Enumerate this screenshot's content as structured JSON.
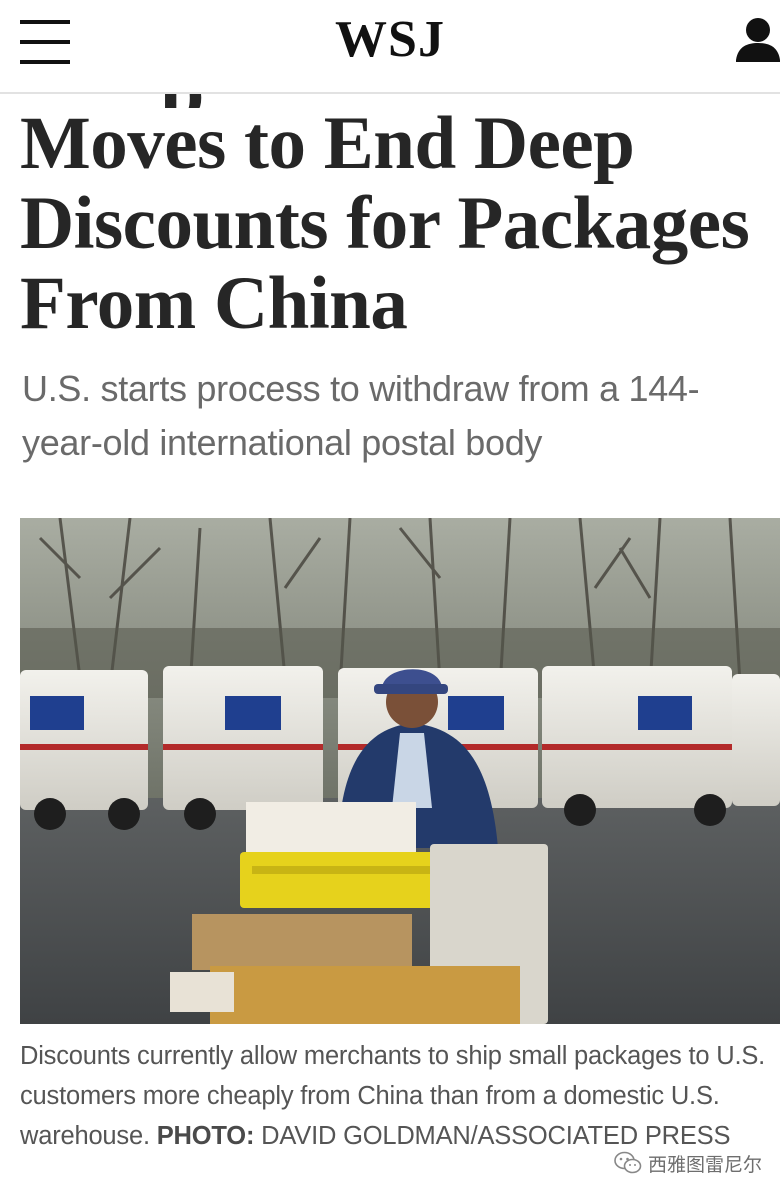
{
  "header": {
    "logo": "WSJ",
    "menu_icon": "hamburger-menu-icon",
    "account_icon": "user-icon"
  },
  "article": {
    "headline": "Moves to End Deep Discounts for Packages From China",
    "dek": "U.S. starts process to withdraw from a 144-year-old international postal body",
    "photo_icon": "usps-mail-carrier-photo",
    "caption": {
      "text": "Discounts currently allow merchants to ship small packages to U.S. customers more cheaply from China than from a domestic U.S. warehouse.",
      "credit_label": "PHOTO:",
      "credit": "DAVID GOLDMAN/ASSOCIATED PRESS"
    }
  },
  "watermark": {
    "icon": "wechat-icon",
    "text": "西雅图雷尼尔"
  }
}
